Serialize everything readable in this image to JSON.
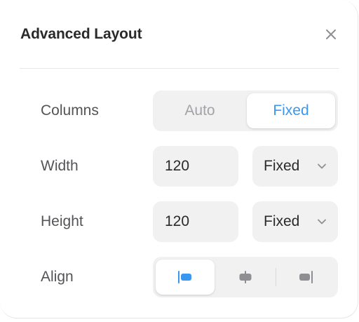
{
  "dialog": {
    "title": "Advanced Layout",
    "close_icon": "close-icon"
  },
  "columns": {
    "label": "Columns",
    "options": [
      "Auto",
      "Fixed"
    ],
    "selected": "Fixed"
  },
  "width": {
    "label": "Width",
    "value": "120",
    "mode": "Fixed",
    "mode_icon": "chevron-down-icon"
  },
  "height": {
    "label": "Height",
    "value": "120",
    "mode": "Fixed",
    "mode_icon": "chevron-down-icon"
  },
  "align": {
    "label": "Align",
    "options": [
      "align-left-icon",
      "align-center-icon",
      "align-right-icon"
    ],
    "selected": "align-left-icon"
  },
  "colors": {
    "accent": "#3a97ef",
    "segment_bg": "#f1f1f2",
    "label_text": "#545458",
    "muted_text": "#a3a3a8",
    "icon_gray": "#8e8e93"
  }
}
